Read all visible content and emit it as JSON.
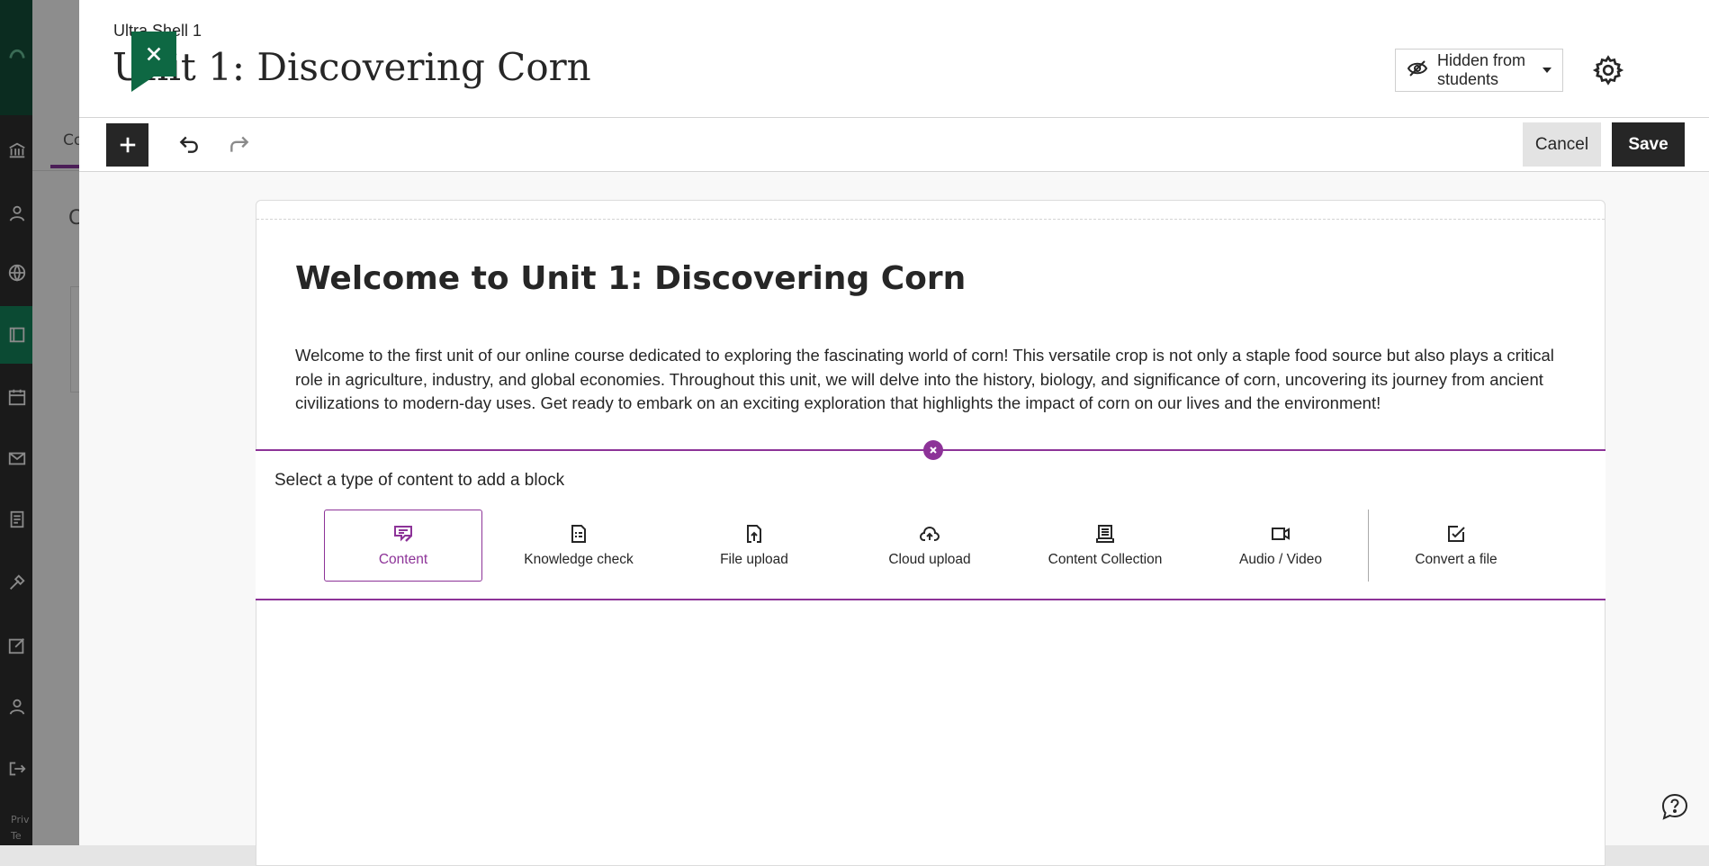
{
  "background_page": {
    "tab_fragment": "Co",
    "heading_fragment": "C",
    "footer_fragments": [
      "Priv",
      "Te"
    ],
    "rail_icons": [
      "logo-icon",
      "institution-icon",
      "profile-icon",
      "globe-icon",
      "courses-icon",
      "calendar-icon",
      "messages-icon",
      "grades-icon",
      "tools-icon",
      "edit-icon",
      "users-icon",
      "signout-icon"
    ]
  },
  "header": {
    "course_name": "Ultra Shell 1",
    "page_title": "Unit 1: Discovering Corn",
    "visibility_label": "Hidden from students",
    "close_icon": "close-icon",
    "settings_icon": "gear-icon"
  },
  "toolbar": {
    "add_icon": "plus-icon",
    "undo_icon": "undo-icon",
    "redo_icon": "redo-icon",
    "cancel_label": "Cancel",
    "save_label": "Save"
  },
  "document": {
    "heading": "Welcome to Unit 1: Discovering Corn",
    "intro": "Welcome to the first unit of our online course dedicated to exploring the fascinating world of corn! This versatile crop is not only a staple food source but also plays a critical role in agriculture, industry, and global economies. Throughout this unit, we will delve into the history, biology, and significance of corn, uncovering its journey from ancient civilizations to modern-day uses. Get ready to embark on an exciting exploration that highlights the impact of corn on our lives and the environment!"
  },
  "block_picker": {
    "prompt": "Select a type of content to add a block",
    "options": [
      {
        "label": "Content",
        "icon": "content-edit-icon",
        "selected": true
      },
      {
        "label": "Knowledge check",
        "icon": "knowledge-check-icon",
        "selected": false
      },
      {
        "label": "File upload",
        "icon": "file-upload-icon",
        "selected": false
      },
      {
        "label": "Cloud upload",
        "icon": "cloud-upload-icon",
        "selected": false
      },
      {
        "label": "Content Collection",
        "icon": "content-collection-icon",
        "selected": false
      },
      {
        "label": "Audio / Video",
        "icon": "video-camera-icon",
        "selected": false
      },
      {
        "label": "Convert a file",
        "icon": "convert-file-icon",
        "selected": false
      }
    ]
  },
  "colors": {
    "accent": "#8d3398",
    "brand_green": "#0e6843",
    "dark_button": "#262626"
  },
  "help_icon": "help-icon"
}
